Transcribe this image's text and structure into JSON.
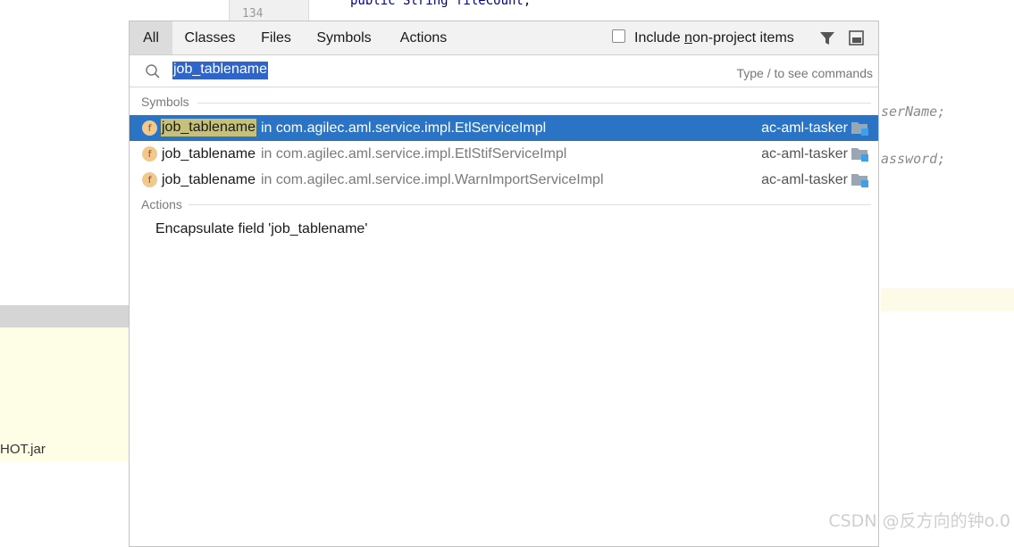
{
  "editor": {
    "gutter_line": "134",
    "code_top": "public String fileCount;",
    "code_fragment_1": "serName;",
    "code_fragment_2": "assword;",
    "left_file_text": "HOT.jar"
  },
  "popup": {
    "tabs": [
      {
        "label": "All",
        "active": true
      },
      {
        "label": "Classes",
        "active": false
      },
      {
        "label": "Files",
        "active": false
      },
      {
        "label": "Symbols",
        "active": false
      },
      {
        "label": "Actions",
        "active": false
      }
    ],
    "include_label_pre": "Include ",
    "include_label_mnemonic": "n",
    "include_label_post": "on-project items",
    "include_checked": false,
    "icons": [
      "filter-icon",
      "pin-window-icon"
    ],
    "search": {
      "value": "job_tablename",
      "hint": "Type / to see commands",
      "icon": "search-icon"
    },
    "symbols_section": "Symbols",
    "symbols": [
      {
        "icon": "field-icon",
        "name": "job_tablename",
        "in": "in com.agilec.aml.service.impl.EtlServiceImpl",
        "module": "ac-aml-tasker",
        "selected": true
      },
      {
        "icon": "field-icon",
        "name": "job_tablename",
        "in": "in com.agilec.aml.service.impl.EtlStifServiceImpl",
        "module": "ac-aml-tasker",
        "selected": false
      },
      {
        "icon": "field-icon",
        "name": "job_tablename",
        "in": "in com.agilec.aml.service.impl.WarnImportServiceImpl",
        "module": "ac-aml-tasker",
        "selected": false
      }
    ],
    "actions_section": "Actions",
    "actions": [
      "Encapsulate field 'job_tablename'"
    ]
  },
  "watermark": "CSDN @反方向的钟o.0",
  "colors": {
    "selection": "#2a73c5",
    "match_highlight": "#c7c07a",
    "search_selection": "#2f65ca"
  }
}
